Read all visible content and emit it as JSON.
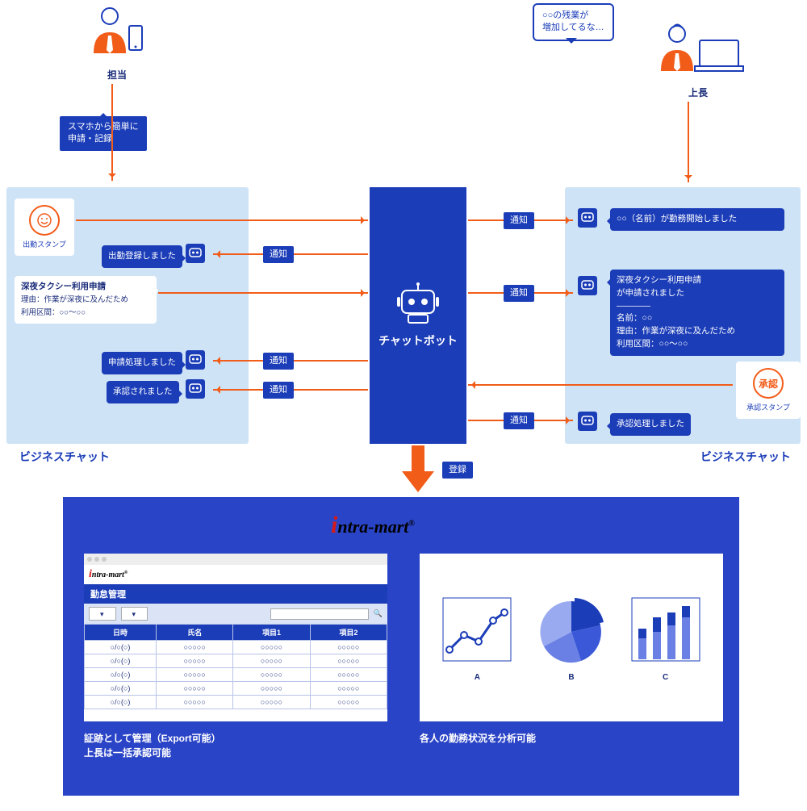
{
  "persona_left_label": "担当",
  "persona_right_label": "上長",
  "thought_right": "○○の残業が\n増加してるな…",
  "tag_left": "スマホから簡単に\n申請・記録",
  "chat_label_left": "ビジネスチャット",
  "chat_label_right": "ビジネスチャット",
  "stamp_out_label": "出勤スタンプ",
  "stamp_approve_text": "承認",
  "stamp_approve_label": "承認スタンプ",
  "bubble_reg_done": "出勤登録しました",
  "bubble_taxi_title": "深夜タクシー利用申請",
  "bubble_taxi_body": "理由：作業が深夜に及んだため\n利用区間：○○～○○",
  "bubble_apply_done": "申請処理しました",
  "bubble_approved": "承認されました",
  "bubble_started": "○○（名前）が勤務開始しました",
  "bubble_taxi_applied": "深夜タクシー利用申請\nが申請されました\n————\n名前：○○\n理由：作業が深夜に及んだため\n利用区間：○○～○○",
  "bubble_approve_done": "承認処理しました",
  "bot_label": "チャットボット",
  "notify": "通知",
  "register": "登録",
  "logo_text": "ntra-mart",
  "bottom_table_title": "勤怠管理",
  "table_headers": [
    "日時",
    "氏名",
    "項目1",
    "項目2"
  ],
  "table_row": [
    "○/○(○)",
    "○○○○○",
    "○○○○○",
    "○○○○○"
  ],
  "caption_left": "証跡として管理（Export可能）\n上長は一括承認可能",
  "caption_right": "各人の勤務状況を分析可能",
  "chart_labels": [
    "A",
    "B",
    "C"
  ]
}
